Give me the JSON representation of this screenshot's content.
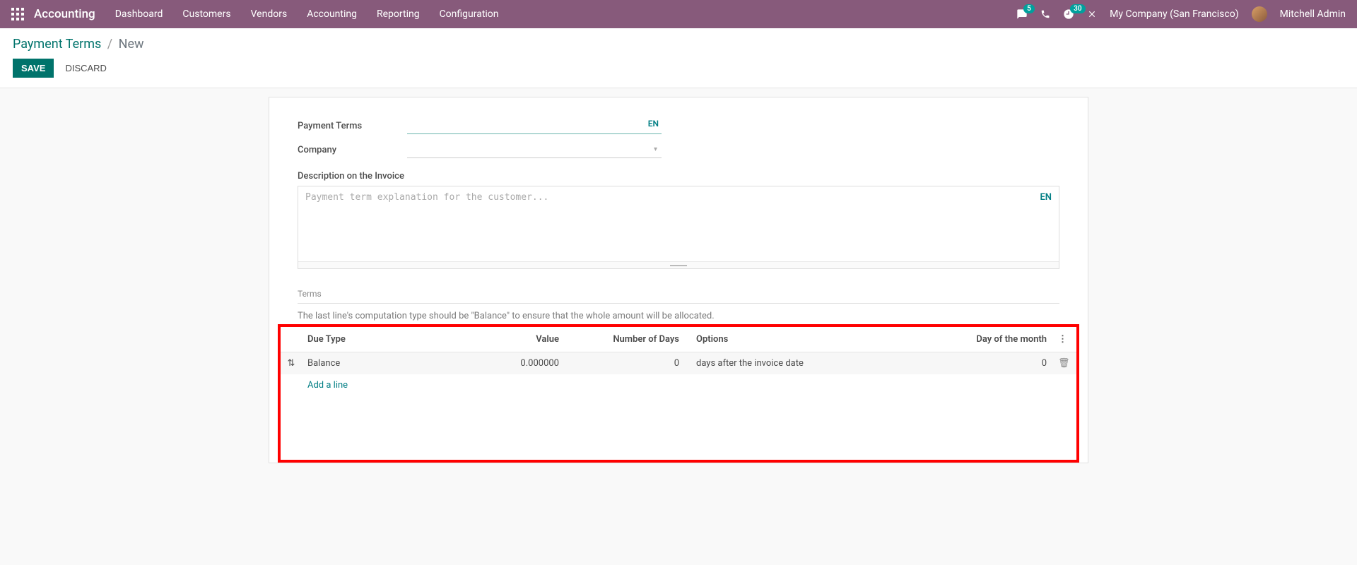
{
  "nav": {
    "brand": "Accounting",
    "items": [
      "Dashboard",
      "Customers",
      "Vendors",
      "Accounting",
      "Reporting",
      "Configuration"
    ],
    "messages_count": "5",
    "activities_count": "30",
    "company": "My Company (San Francisco)",
    "user": "Mitchell Admin"
  },
  "breadcrumb": {
    "parent": "Payment Terms",
    "current": "New"
  },
  "actions": {
    "save": "SAVE",
    "discard": "DISCARD"
  },
  "form": {
    "labels": {
      "payment_terms": "Payment Terms",
      "company": "Company",
      "description": "Description on the Invoice"
    },
    "lang_badge": "EN",
    "description_placeholder": "Payment term explanation for the customer..."
  },
  "terms_section": {
    "title": "Terms",
    "hint": "The last line's computation type should be \"Balance\" to ensure that the whole amount will be allocated.",
    "columns": {
      "due_type": "Due Type",
      "value": "Value",
      "number_of_days": "Number of Days",
      "options": "Options",
      "day_of_month": "Day of the month"
    },
    "rows": [
      {
        "due_type": "Balance",
        "value": "0.000000",
        "number_of_days": "0",
        "options": "days after the invoice date",
        "day_of_month": "0"
      }
    ],
    "add_line": "Add a line"
  }
}
